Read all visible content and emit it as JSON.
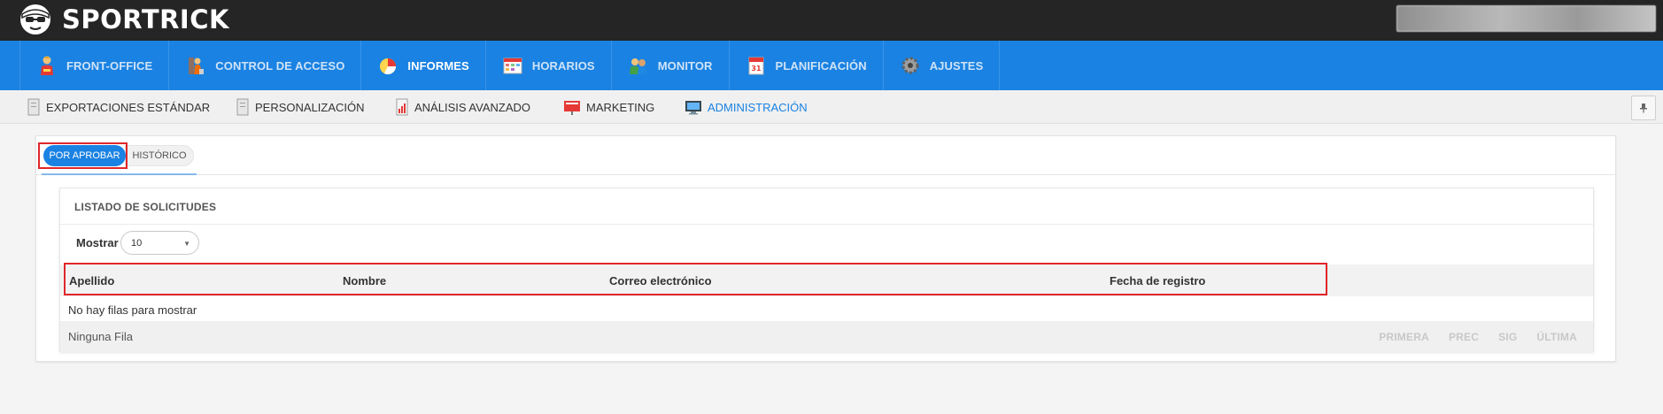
{
  "app": {
    "brand": "SPORTRICK",
    "accent_color": "#1a82e2",
    "highlight_color": "#e0262b"
  },
  "main_nav": [
    {
      "label": "FRONT-OFFICE",
      "icon": "person-icon",
      "active": false
    },
    {
      "label": "CONTROL DE ACCESO",
      "icon": "access-control-icon",
      "active": false
    },
    {
      "label": "INFORMES",
      "icon": "pie-chart-icon",
      "active": true
    },
    {
      "label": "HORARIOS",
      "icon": "calendar-grid-icon",
      "active": false
    },
    {
      "label": "MONITOR",
      "icon": "people-icon",
      "active": false
    },
    {
      "label": "PLANIFICACIÓN",
      "icon": "planner-icon",
      "active": false
    },
    {
      "label": "AJUSTES",
      "icon": "gear-icon",
      "active": false
    }
  ],
  "sub_nav": [
    {
      "label": "EXPORTACIONES ESTÁNDAR",
      "icon": "document-icon",
      "active": false
    },
    {
      "label": "PERSONALIZACIÓN",
      "icon": "document-icon",
      "active": false
    },
    {
      "label": "ANÁLISIS AVANZADO",
      "icon": "report-icon",
      "active": false
    },
    {
      "label": "MARKETING",
      "icon": "marketing-icon",
      "active": false
    },
    {
      "label": "ADMINISTRACIÓN",
      "icon": "monitor-icon",
      "active": true
    }
  ],
  "tabs": {
    "active": "POR APROBAR",
    "inactive": "HISTÓRICO"
  },
  "listing": {
    "title": "LISTADO DE SOLICITUDES",
    "show_label": "Mostrar",
    "page_size": "10",
    "columns": [
      "Apellido",
      "Nombre",
      "Correo electrónico",
      "Fecha de registro"
    ],
    "rows": [],
    "empty_message": "No hay filas para mostrar",
    "footer_info": "Ninguna Fila",
    "pager": {
      "first": "PRIMERA",
      "prev": "PREC",
      "next": "SIG",
      "last": "ÚLTIMA"
    }
  }
}
